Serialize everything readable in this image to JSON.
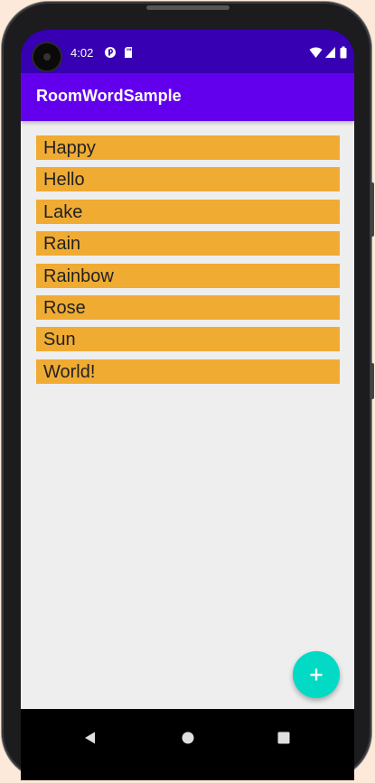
{
  "status_bar": {
    "time": "4:02",
    "icons": [
      "app-notification-icon",
      "sd-card-icon",
      "wifi-icon",
      "cell-signal-icon",
      "battery-icon"
    ]
  },
  "app_bar": {
    "title": "RoomWordSample"
  },
  "word_list": {
    "items": [
      "Happy",
      "Hello",
      "Lake",
      "Rain",
      "Rainbow",
      "Rose",
      "Sun",
      "World!"
    ],
    "item_color": "#f0ab33"
  },
  "fab": {
    "icon": "plus-icon",
    "color": "#03dac5"
  },
  "nav_bar": {
    "icons": [
      "back-icon",
      "home-icon",
      "recents-icon"
    ]
  },
  "colors": {
    "primary": "#6200ee",
    "primary_dark": "#3700b3",
    "background": "#eeeeee"
  }
}
